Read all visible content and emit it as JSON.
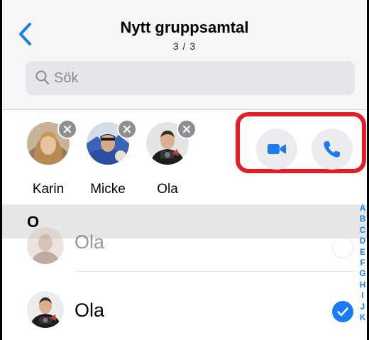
{
  "header": {
    "title": "Nytt gruppsamtal",
    "subtitle": "3 / 3"
  },
  "search": {
    "placeholder": "Sök"
  },
  "selected": [
    {
      "name": "Karin"
    },
    {
      "name": "Micke"
    },
    {
      "name": "Ola"
    }
  ],
  "section": {
    "letter": "O"
  },
  "rows": [
    {
      "name": "Ola",
      "checked": false
    },
    {
      "name": "Ola",
      "checked": true
    }
  ],
  "index": [
    "A",
    "B",
    "C",
    "D",
    "E",
    "F",
    "G",
    "H",
    "I",
    "J",
    "K"
  ],
  "colors": {
    "accent": "#1a7cf5",
    "highlight": "#e41e26"
  }
}
